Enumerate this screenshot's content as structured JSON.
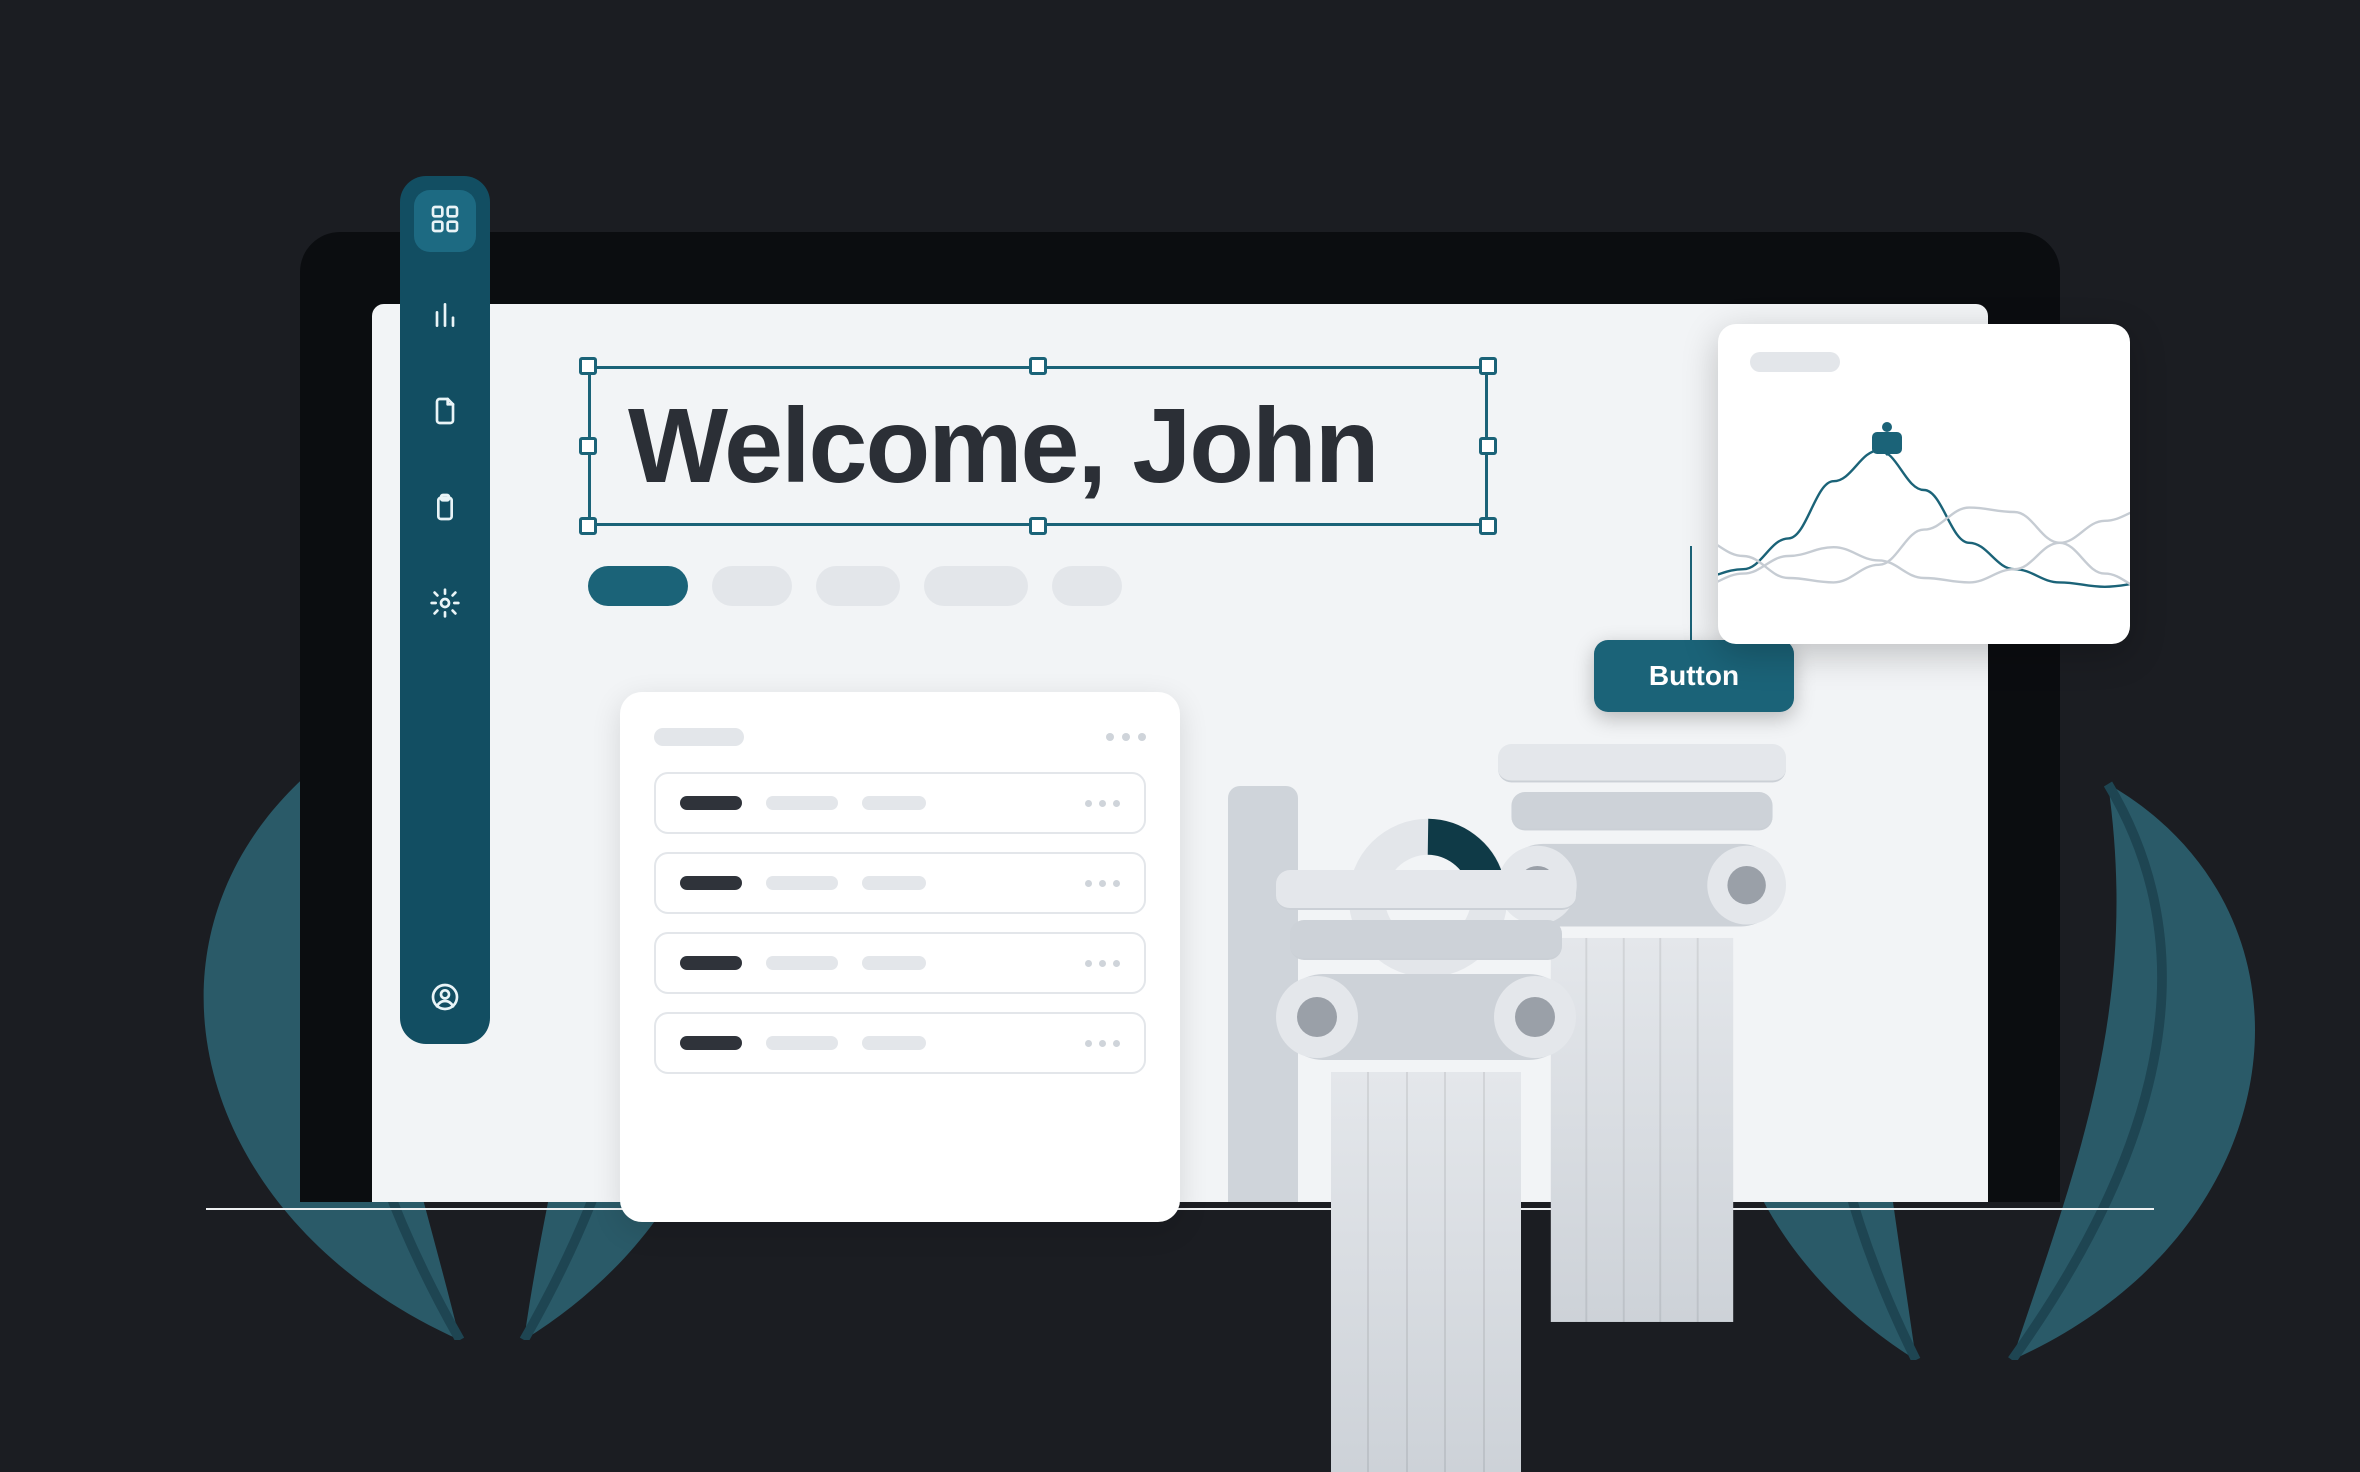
{
  "header": {
    "welcome": "Welcome, John"
  },
  "cta": {
    "label": "Button"
  },
  "sidebar": {
    "items": [
      {
        "name": "dashboard",
        "icon": "grid",
        "active": true
      },
      {
        "name": "analytics",
        "icon": "bar-chart",
        "active": false
      },
      {
        "name": "documents",
        "icon": "file",
        "active": false
      },
      {
        "name": "clipboard",
        "icon": "clipboard",
        "active": false
      },
      {
        "name": "settings",
        "icon": "gear",
        "active": false
      }
    ],
    "footer": {
      "name": "account",
      "icon": "user-circle"
    }
  },
  "tabs": {
    "count": 5,
    "active_index": 0
  },
  "list_card": {
    "rows": 4
  },
  "colors": {
    "accent": "#1b6378",
    "sidebar": "#124e62",
    "background": "#1b1d22"
  },
  "chart_data": {
    "type": "line",
    "title": "",
    "xlabel": "",
    "ylabel": "",
    "x": [
      0,
      1,
      2,
      3,
      4,
      5,
      6,
      7,
      8,
      9,
      10
    ],
    "series": [
      {
        "name": "primary",
        "values": [
          30,
          34,
          48,
          74,
          88,
          70,
          46,
          34,
          28,
          26,
          28
        ],
        "color": "#1b6378"
      },
      {
        "name": "secondary",
        "values": [
          48,
          40,
          30,
          28,
          36,
          52,
          62,
          60,
          46,
          32,
          24
        ],
        "color": "#c6ccd3"
      },
      {
        "name": "tertiary",
        "values": [
          26,
          32,
          40,
          44,
          38,
          30,
          28,
          34,
          46,
          56,
          62
        ],
        "color": "#c6ccd3"
      }
    ],
    "highlight_index": 3,
    "ylim": [
      0,
      100
    ]
  }
}
